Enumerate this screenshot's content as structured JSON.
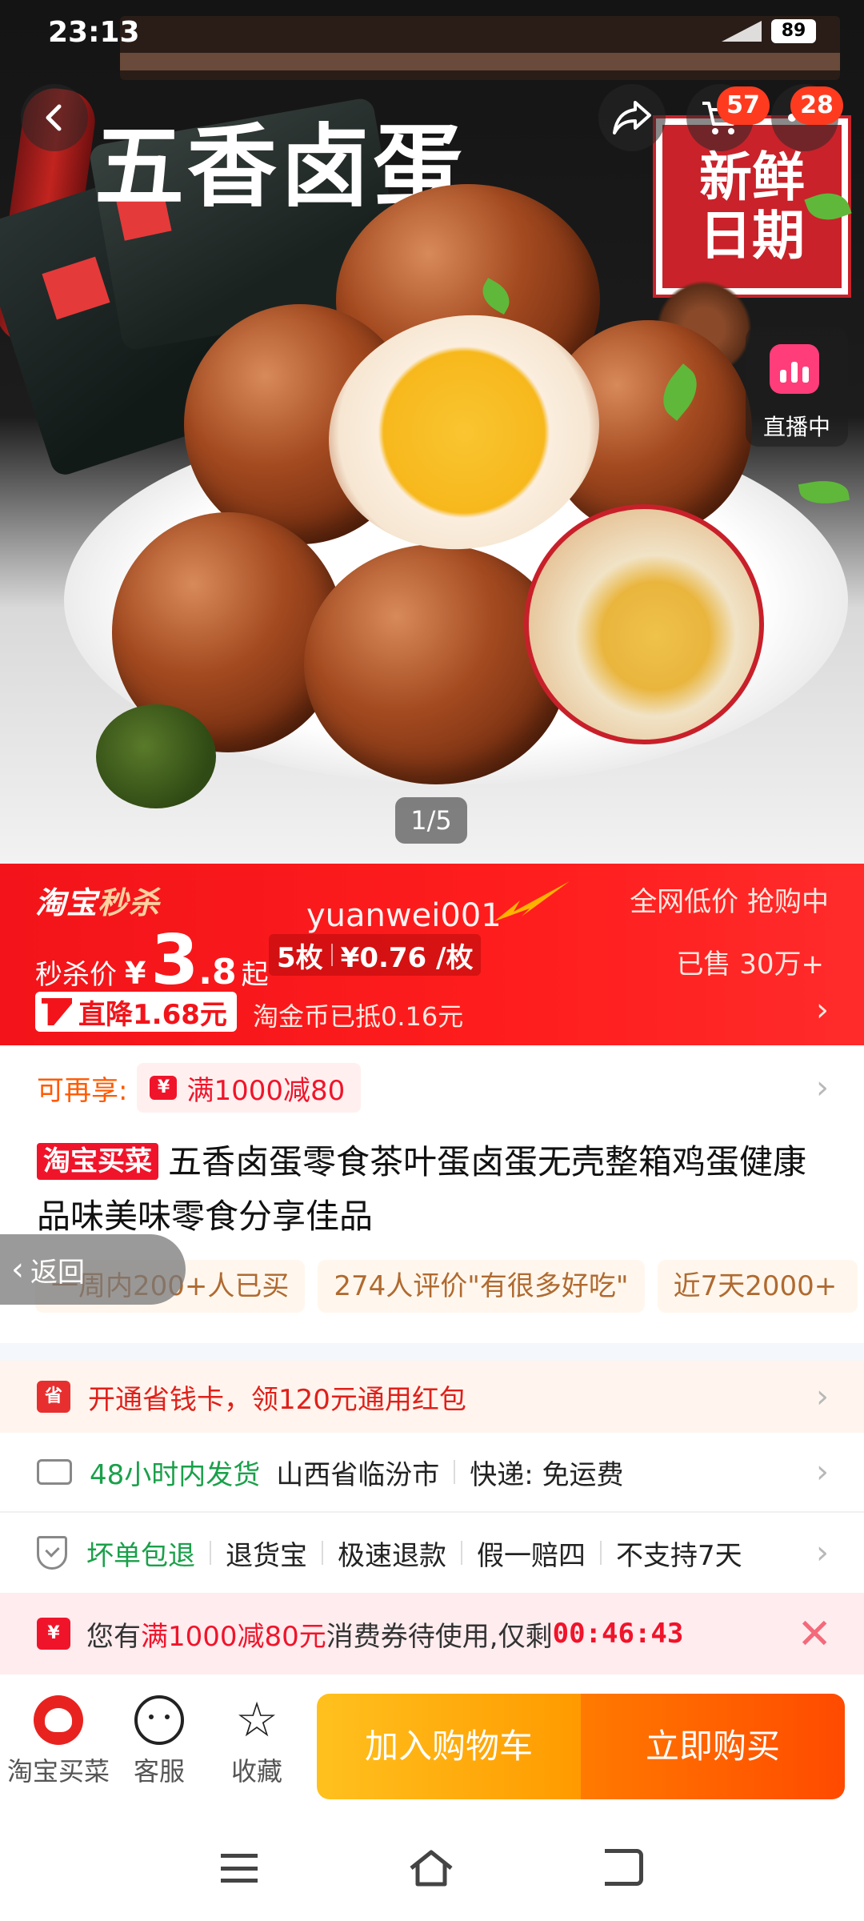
{
  "status_bar": {
    "time": "23:13",
    "battery": "89"
  },
  "hero": {
    "art_title": "五香卤蛋",
    "fresh_badge_line1": "新鲜",
    "fresh_badge_line2": "日期",
    "cart_count": "57",
    "more_count": "28",
    "live_label": "直播中",
    "pager": "1/5"
  },
  "sale": {
    "logo_part1": "淘宝",
    "logo_part2": "秒杀",
    "watermark": "yuanwei001",
    "hint": "全网低价 抢购中",
    "price_label": "秒杀价",
    "currency": "¥",
    "price_int": "3",
    "price_dec": ".8",
    "price_suffix": "起",
    "unit_count": "5枚",
    "unit_price": "¥0.76 /枚",
    "sold": "已售 30万+",
    "drop_tag": "直降1.68元",
    "coin_note": "淘金币已抵0.16元"
  },
  "info": {
    "extra_label": "可再享:",
    "coupon_icon": "¥",
    "coupon_text": "满1000减80",
    "title_tag": "淘宝买菜",
    "title": "五香卤蛋零食茶叶蛋卤蛋无壳整箱鸡蛋健康品味美味零食分享佳品",
    "pills": [
      "一周内200+人已买",
      "274人评价\"有很多好吃\"",
      "近7天2000+"
    ],
    "floating_back": "返回"
  },
  "services": {
    "card_icon": "省",
    "card_text": "开通省钱卡，领120元通用红包",
    "ship_highlight": "48小时内发货",
    "ship_from": "山西省临汾市",
    "ship_fee": "快递: 免运费",
    "ret_highlight": "坏单包退",
    "ret_items": [
      "退货宝",
      "极速退款",
      "假一赔四",
      "不支持7天"
    ]
  },
  "voucher": {
    "icon": "¥",
    "prefix": "您有",
    "amount": "满1000减80元",
    "middle": "消费券待使用,仅剩",
    "timer": "00:46:43",
    "close": "✕"
  },
  "actionbar": {
    "shop_label": "淘宝买菜",
    "service_label": "客服",
    "fav_label": "收藏",
    "fav_icon": "☆",
    "add_cart": "加入购物车",
    "buy_now": "立即购买"
  },
  "colors": {
    "sale_red": "#f2141a",
    "cart_orange": "#ffa800",
    "buy_orange": "#ff5a00",
    "ship_green": "#1aa04a"
  }
}
